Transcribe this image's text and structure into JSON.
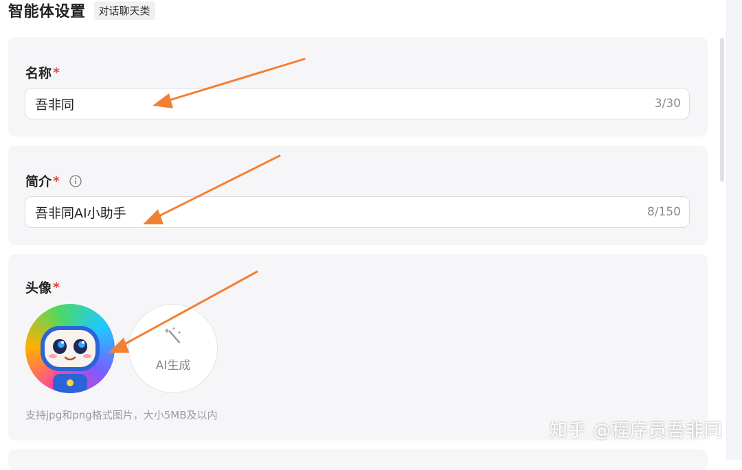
{
  "header": {
    "title": "智能体设置",
    "tag": "对话聊天类"
  },
  "name_field": {
    "label": "名称",
    "required_mark": "*",
    "value": "吾非同",
    "counter": "3/30"
  },
  "intro_field": {
    "label": "简介",
    "required_mark": "*",
    "value": "吾非同AI小助手",
    "counter": "8/150",
    "info_icon": "info-icon"
  },
  "avatar_field": {
    "label": "头像",
    "required_mark": "*",
    "ai_generate_label": "AI生成",
    "ai_generate_icon": "magic-wand-icon",
    "hint": "支持jpg和png格式图片，大小5MB及以内"
  },
  "watermark": "知乎 @程序员吾非同",
  "colors": {
    "accent_arrow": "#f28032",
    "required": "#e0443a",
    "card_bg": "#f6f6f8"
  }
}
